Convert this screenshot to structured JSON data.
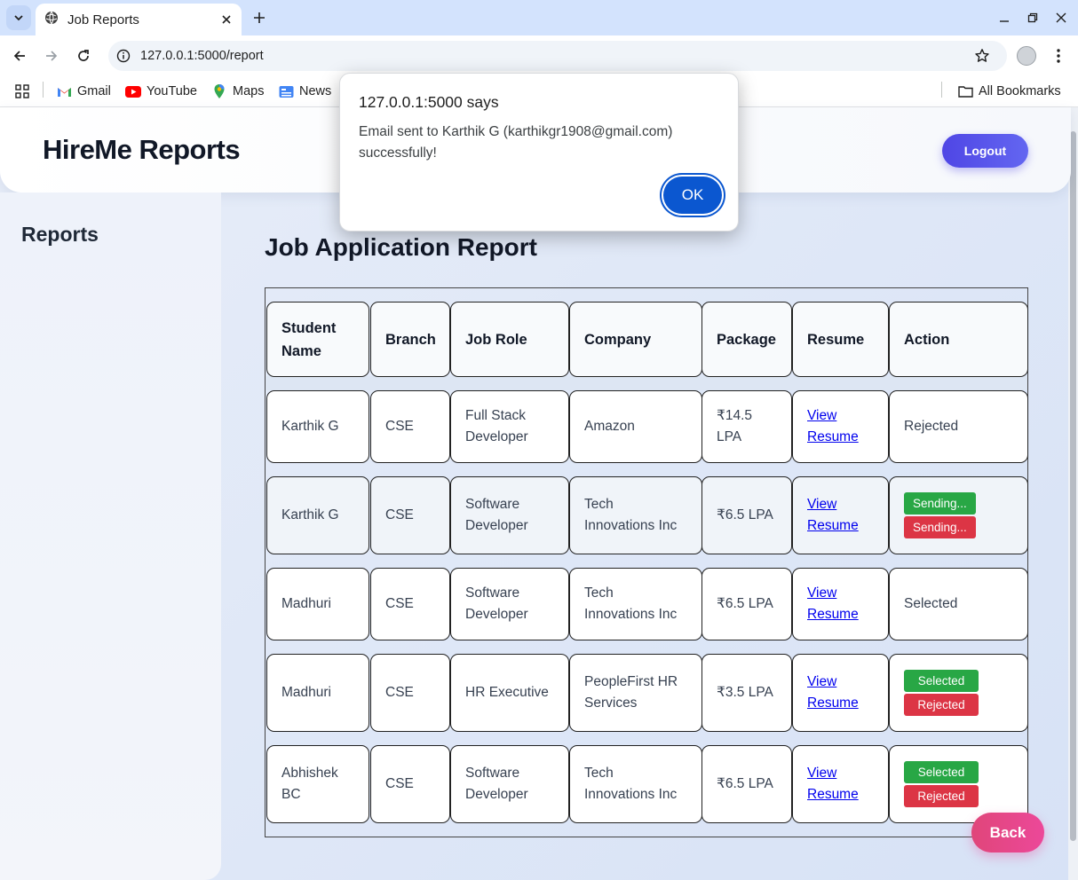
{
  "browser": {
    "tab_title": "Job Reports",
    "url": "127.0.0.1:5000/report",
    "bookmarks": [
      "Gmail",
      "YouTube",
      "Maps",
      "News"
    ],
    "all_bookmarks": "All Bookmarks"
  },
  "header": {
    "brand": "HireMe Reports",
    "logout": "Logout"
  },
  "sidebar": {
    "title": "Reports"
  },
  "main": {
    "title": "Job Application Report",
    "columns": [
      "Student Name",
      "Branch",
      "Job Role",
      "Company",
      "Package",
      "Resume",
      "Action"
    ],
    "rows": [
      {
        "name": "Karthik G",
        "branch": "CSE",
        "role": "Full Stack Developer",
        "company": "Amazon",
        "package": "₹14.5 LPA",
        "resume": "View Resume",
        "action_text": "Rejected",
        "buttons": []
      },
      {
        "name": "Karthik G",
        "branch": "CSE",
        "role": "Software Developer",
        "company": "Tech Innovations Inc",
        "package": "₹6.5 LPA",
        "resume": "View Resume",
        "action_text": "",
        "buttons": [
          "Sending...",
          "Sending..."
        ]
      },
      {
        "name": "Madhuri",
        "branch": "CSE",
        "role": "Software Developer",
        "company": "Tech Innovations Inc",
        "package": "₹6.5 LPA",
        "resume": "View Resume",
        "action_text": "Selected",
        "buttons": []
      },
      {
        "name": "Madhuri",
        "branch": "CSE",
        "role": "HR Executive",
        "company": "PeopleFirst HR Services",
        "package": "₹3.5 LPA",
        "resume": "View Resume",
        "action_text": "",
        "buttons": [
          "Selected",
          "Rejected"
        ]
      },
      {
        "name": "Abhishek BC",
        "branch": "CSE",
        "role": "Software Developer",
        "company": "Tech Innovations Inc",
        "package": "₹6.5 LPA",
        "resume": "View Resume",
        "action_text": "",
        "buttons": [
          "Selected",
          "Rejected"
        ]
      }
    ],
    "back": "Back"
  },
  "dialog": {
    "title": "127.0.0.1:5000 says",
    "message": "Email sent to Karthik G (karthikgr1908@gmail.com) successfully!",
    "ok": "OK"
  },
  "colors": {
    "accent": "#4f46e5",
    "back_button": "#ec4899",
    "success": "#28a745",
    "danger": "#dc3545",
    "dialog_ok": "#0b57d0"
  }
}
